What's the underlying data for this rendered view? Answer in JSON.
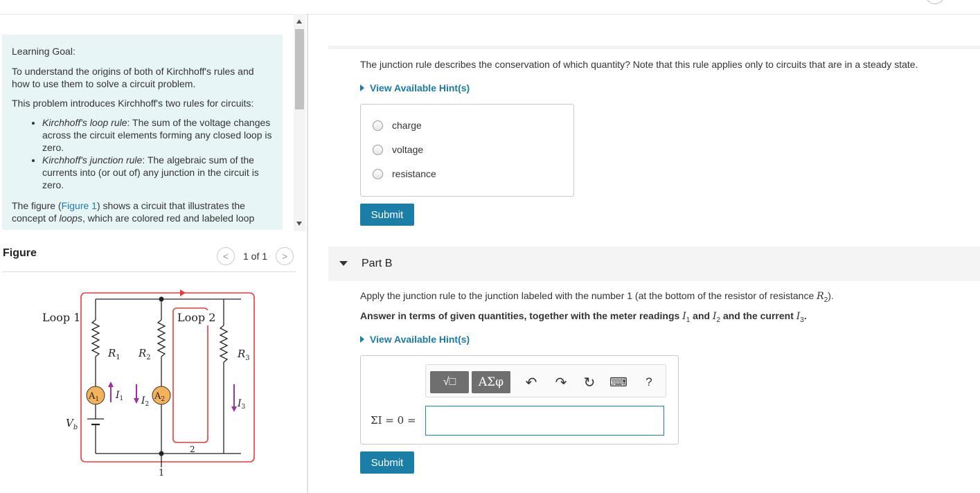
{
  "left": {
    "goal_title": "Learning Goal:",
    "goal_text_1": "To understand the origins of both of Kirchhoff's rules and how to use them to solve a circuit problem.",
    "goal_text_2": "This problem introduces Kirchhoff's two rules for circuits:",
    "rules": [
      {
        "name": "Kirchhoff's loop rule",
        "text": ": The sum of the voltage changes across the circuit elements forming any closed loop is zero."
      },
      {
        "name": "Kirchhoff's junction rule",
        "text": ": The algebraic sum of the currents into (or out of) any junction in the circuit is zero."
      }
    ],
    "figure_text_1": "The figure (",
    "figure_link": "Figure 1",
    "figure_text_2": ") shows a circuit that illustrates the concept of ",
    "figure_text_em": "loops",
    "figure_text_3": ", which are colored red and labeled loop"
  },
  "figure": {
    "label": "Figure",
    "count": "1 of 1",
    "prev": "<",
    "next": ">",
    "loop1": "Loop 1",
    "loop2": "Loop 2",
    "r1": "R",
    "r1_sub": "1",
    "r2": "R",
    "r2_sub": "2",
    "r3": "R",
    "r3_sub": "3",
    "a1": "A",
    "a1_sub": "1",
    "a2": "A",
    "a2_sub": "2",
    "i1": "I",
    "i1_sub": "1",
    "i2": "I",
    "i2_sub": "2",
    "i3": "I",
    "i3_sub": "3",
    "vb": "V",
    "vb_sub": "b",
    "node1": "1",
    "node2": "2"
  },
  "partA": {
    "question": "The junction rule describes the conservation of which quantity? Note that this rule applies only to circuits that are in a steady state.",
    "hint": "View Available Hint(s)",
    "options": [
      "charge",
      "voltage",
      "resistance"
    ],
    "submit": "Submit"
  },
  "partB": {
    "label": "Part B",
    "question_1": "Apply the junction rule to the junction labeled with the number 1 (at the bottom of the resistor of resistance ",
    "question_r": "R",
    "question_r_sub": "2",
    "question_2": ").",
    "instruction_1": "Answer in terms of given quantities, together with the meter readings ",
    "instruction_i1": "I",
    "instruction_i1_sub": "1",
    "instruction_and": " and ",
    "instruction_i2": "I",
    "instruction_i2_sub": "2",
    "instruction_2": " and the current ",
    "instruction_i3": "I",
    "instruction_i3_sub": "3",
    "instruction_3": ".",
    "hint": "View Available Hint(s)",
    "toolbar_btn1": "√□",
    "toolbar_btn2": "ΑΣφ",
    "undo": "↶",
    "redo": "↷",
    "reset": "↻",
    "keyboard": "⌨",
    "help": "?",
    "eq_label": "ΣI = 0 =",
    "input_value": "",
    "submit": "Submit"
  },
  "colors": {
    "accent": "#1b7ea6",
    "loop_red": "#e83a3a",
    "ammeter_orange": "#f6b25b",
    "current_purple": "#a0309a"
  }
}
